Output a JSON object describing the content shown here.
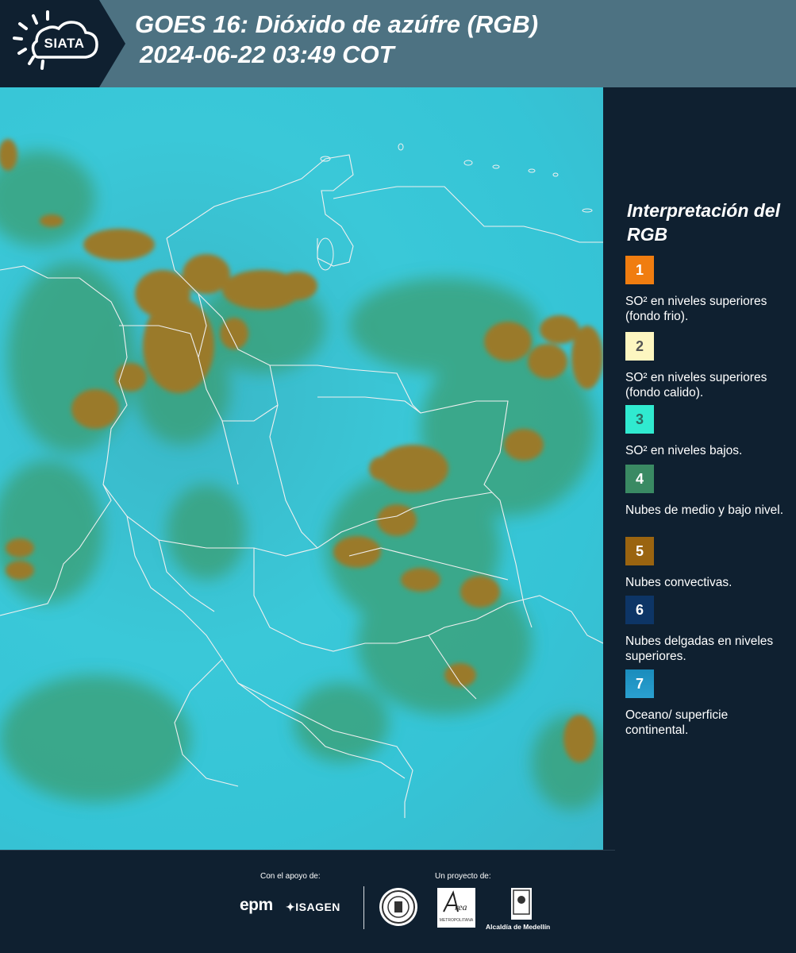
{
  "header": {
    "logo_text": "SIATA",
    "title_line1": "GOES 16: Dióxido de azúfre (RGB)",
    "title_line2": "2024-06-22 03:49 COT"
  },
  "map": {
    "description_icon": "satellite-rgb-map",
    "background_color": "#3ac8d8"
  },
  "legend": {
    "title": "Interpretación del RGB",
    "items": [
      {
        "number": "1",
        "color": "#f07d10",
        "text": "SO² en niveles superiores (fondo frio)."
      },
      {
        "number": "2",
        "color": "#fdf6c0",
        "text": "SO² en niveles superiores (fondo calido)."
      },
      {
        "number": "3",
        "color": "#30ead0",
        "text": "SO² en niveles bajos."
      },
      {
        "number": "4",
        "color": "#3a8a63",
        "text": "Nubes de medio y bajo nivel."
      },
      {
        "number": "5",
        "color": "#9a6410",
        "text": "Nubes convectivas."
      },
      {
        "number": "6",
        "color": "#0d3566",
        "text": "Nubes delgadas en niveles superiores."
      },
      {
        "number": "7",
        "color": "#1a8cbc",
        "text": "Oceano/ superficie continental."
      }
    ]
  },
  "footer": {
    "support_label": "Con el apoyo de:",
    "project_label": "Un proyecto de:",
    "epm": "epm",
    "isagen": "ISAGEN",
    "area_text": "METROPOLITANA",
    "alcaldia": "Alcaldía de Medellín"
  }
}
